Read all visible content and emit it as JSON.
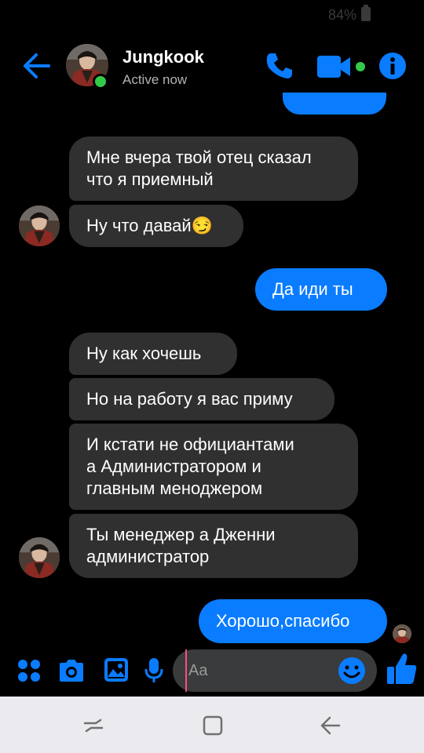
{
  "status_bar": {
    "battery": "84%"
  },
  "header": {
    "contact_name": "Jungkook",
    "status": "Active now"
  },
  "conversation": {
    "messages": [
      {
        "direction": "incoming",
        "text_lines": [
          "Мне вчера твой отец сказал",
          "что я приемный"
        ]
      },
      {
        "direction": "incoming",
        "text": "Ну что давай😏"
      },
      {
        "direction": "outgoing",
        "text": "Да иди ты"
      },
      {
        "direction": "incoming",
        "text": "Ну как хочешь"
      },
      {
        "direction": "incoming",
        "text": "Но на работу я вас приму"
      },
      {
        "direction": "incoming",
        "text_lines": [
          "И кстати не официантами",
          "а Администратором и",
          "главным меноджером"
        ]
      },
      {
        "direction": "incoming",
        "text_lines": [
          "Ты менеджер а Дженни",
          "администратор"
        ]
      },
      {
        "direction": "outgoing",
        "text": "Хорошо,спасибо"
      }
    ]
  },
  "composer": {
    "placeholder": "Aa"
  },
  "icons": {
    "back": "arrow-left-icon",
    "call": "phone-icon",
    "video": "video-camera-icon",
    "info": "info-icon",
    "apps": "four-dots-icon",
    "camera": "camera-icon",
    "gallery": "image-icon",
    "voice": "microphone-icon",
    "emoji": "smiley-icon",
    "like": "thumbs-up-icon"
  },
  "colors": {
    "accent": "#0a7cff",
    "incoming_bubble": "#303030",
    "active_dot": "#33c94a",
    "background": "#000000"
  }
}
